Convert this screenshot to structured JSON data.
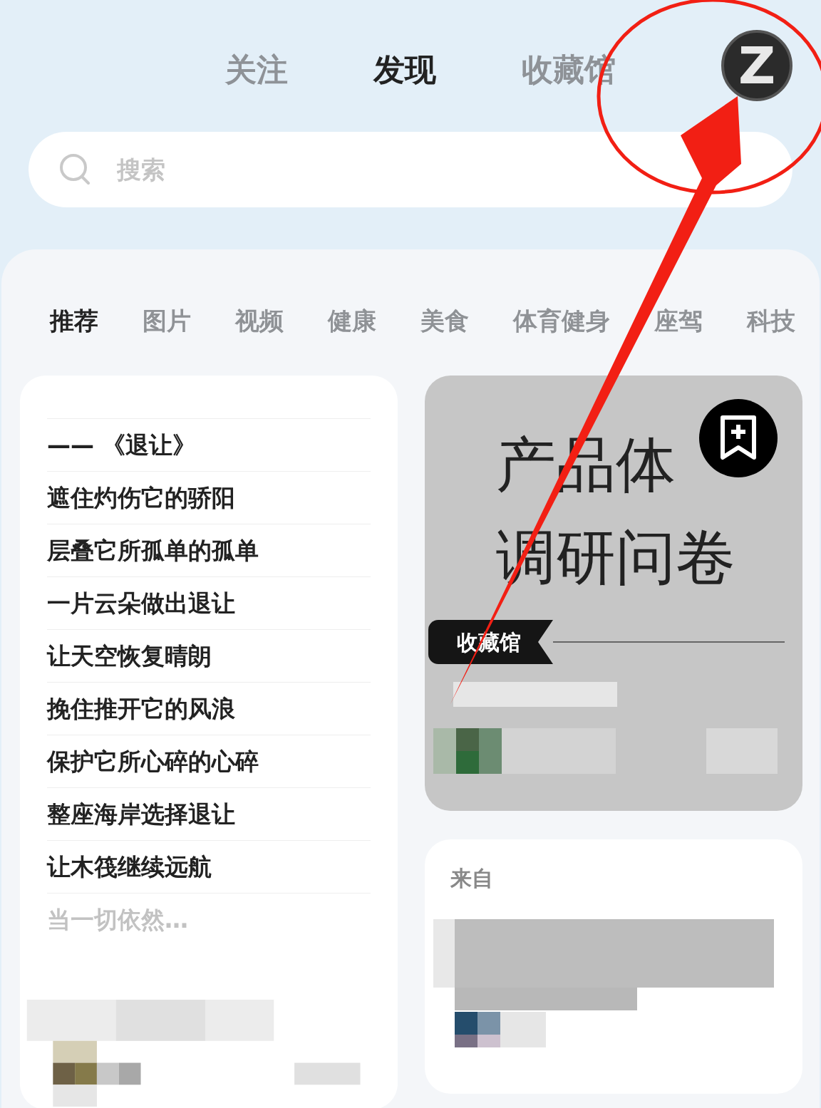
{
  "top_tabs": [
    {
      "label": "关注",
      "selected": false
    },
    {
      "label": "发现",
      "selected": true
    },
    {
      "label": "收藏馆",
      "selected": false
    }
  ],
  "avatar": {
    "letter": "Z"
  },
  "search": {
    "placeholder": "搜索"
  },
  "categories": [
    {
      "label": "推荐",
      "selected": true
    },
    {
      "label": "图片",
      "selected": false
    },
    {
      "label": "视频",
      "selected": false
    },
    {
      "label": "健康",
      "selected": false
    },
    {
      "label": "美食",
      "selected": false
    },
    {
      "label": "体育健身",
      "selected": false
    },
    {
      "label": "座驾",
      "selected": false
    },
    {
      "label": "科技",
      "selected": false
    }
  ],
  "poem_card": {
    "lines": [
      {
        "text": "—— 《退让》",
        "faded": false
      },
      {
        "text": "遮住灼伤它的骄阳",
        "faded": false
      },
      {
        "text": "层叠它所孤单的孤单",
        "faded": false
      },
      {
        "text": "一片云朵做出退让",
        "faded": false
      },
      {
        "text": "让天空恢复晴朗",
        "faded": false
      },
      {
        "text": "挽住推开它的风浪",
        "faded": false
      },
      {
        "text": "保护它所心碎的心碎",
        "faded": false
      },
      {
        "text": "整座海岸选择退让",
        "faded": false
      },
      {
        "text": "让木筏继续远航",
        "faded": false
      },
      {
        "text": "当一切依然…",
        "faded": true
      }
    ]
  },
  "survey_card": {
    "title_lines": [
      "产品体",
      "调研问卷"
    ],
    "tag": "收藏馆"
  },
  "source_card": {
    "from": "来自"
  }
}
